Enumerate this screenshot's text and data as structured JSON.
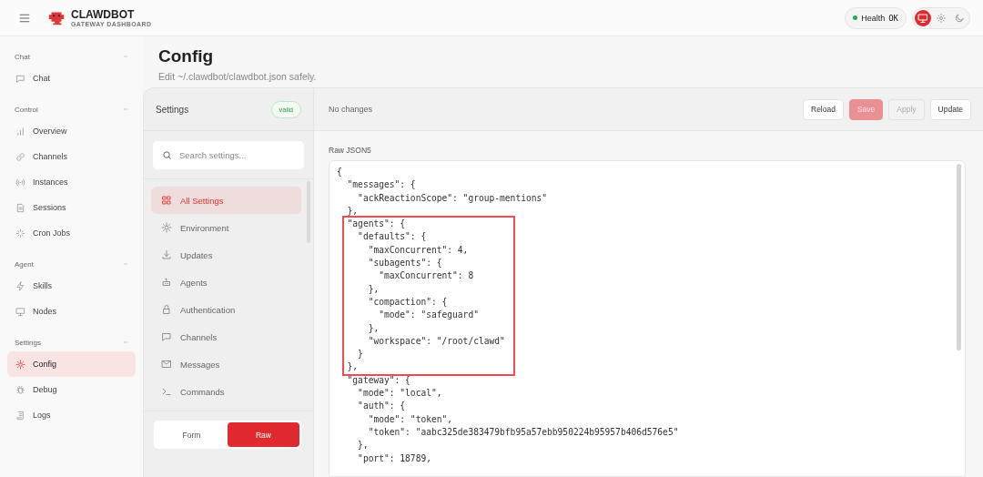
{
  "header": {
    "brand": "CLAWDBOT",
    "subtitle": "GATEWAY DASHBOARD",
    "health": {
      "label": "Health",
      "value": "OK",
      "ok": true
    },
    "theme_modes": [
      {
        "selected": true
      },
      {
        "selected": false
      },
      {
        "selected": false
      }
    ]
  },
  "sidebar": {
    "groups": [
      {
        "title": "Chat",
        "expanded": true,
        "items": [
          {
            "label": "Chat",
            "selected": false
          }
        ]
      },
      {
        "title": "Control",
        "expanded": true,
        "items": [
          {
            "label": "Overview",
            "selected": false
          },
          {
            "label": "Channels",
            "selected": false
          },
          {
            "label": "Instances",
            "selected": false
          },
          {
            "label": "Sessions",
            "selected": false
          },
          {
            "label": "Cron Jobs",
            "selected": false
          }
        ]
      },
      {
        "title": "Agent",
        "expanded": true,
        "items": [
          {
            "label": "Skills",
            "selected": false
          },
          {
            "label": "Nodes",
            "selected": false
          }
        ]
      },
      {
        "title": "Settings",
        "expanded": true,
        "items": [
          {
            "label": "Config",
            "selected": true
          },
          {
            "label": "Debug",
            "selected": false
          },
          {
            "label": "Logs",
            "selected": false
          }
        ]
      }
    ]
  },
  "page": {
    "title": "Config",
    "subtitle": "Edit ~/.clawdbot/clawdbot.json safely."
  },
  "settings_panel": {
    "title": "Settings",
    "status": "valid",
    "valid": true,
    "search": {
      "placeholder": "Search settings..."
    },
    "items": [
      {
        "label": "All Settings",
        "selected": true
      },
      {
        "label": "Environment",
        "selected": false
      },
      {
        "label": "Updates",
        "selected": false
      },
      {
        "label": "Agents",
        "selected": false
      },
      {
        "label": "Authentication",
        "selected": false
      },
      {
        "label": "Channels",
        "selected": false
      },
      {
        "label": "Messages",
        "selected": false
      },
      {
        "label": "Commands",
        "selected": false
      }
    ],
    "modes": [
      {
        "label": "Form",
        "selected": false
      },
      {
        "label": "Raw",
        "selected": true
      }
    ]
  },
  "editor": {
    "status": "No changes",
    "buttons": [
      {
        "label": "Reload",
        "kind": "default",
        "disabled": false
      },
      {
        "label": "Save",
        "kind": "primary",
        "disabled": true
      },
      {
        "label": "Apply",
        "kind": "default",
        "disabled": true
      },
      {
        "label": "Update",
        "kind": "default",
        "disabled": false
      }
    ],
    "label": "Raw JSON5",
    "lines": [
      {
        "text": "{",
        "highlighted": false
      },
      {
        "text": "  \"messages\": {",
        "highlighted": false
      },
      {
        "text": "    \"ackReactionScope\": \"group-mentions\"",
        "highlighted": false
      },
      {
        "text": "  },",
        "highlighted": false
      },
      {
        "text": "  \"agents\": {",
        "highlighted": true
      },
      {
        "text": "    \"defaults\": {",
        "highlighted": true
      },
      {
        "text": "      \"maxConcurrent\": 4,",
        "highlighted": true
      },
      {
        "text": "      \"subagents\": {",
        "highlighted": true
      },
      {
        "text": "        \"maxConcurrent\": 8",
        "highlighted": true
      },
      {
        "text": "      },",
        "highlighted": true
      },
      {
        "text": "      \"compaction\": {",
        "highlighted": true
      },
      {
        "text": "        \"mode\": \"safeguard\"",
        "highlighted": true
      },
      {
        "text": "      },",
        "highlighted": true
      },
      {
        "text": "      \"workspace\": \"/root/clawd\"",
        "highlighted": true
      },
      {
        "text": "    }",
        "highlighted": true
      },
      {
        "text": "  },",
        "highlighted": true
      },
      {
        "text": "  \"gateway\": {",
        "highlighted": false
      },
      {
        "text": "    \"mode\": \"local\",",
        "highlighted": false
      },
      {
        "text": "    \"auth\": {",
        "highlighted": false
      },
      {
        "text": "      \"mode\": \"token\",",
        "highlighted": false
      },
      {
        "text": "      \"token\": \"aabc325de383479bfb95a57ebb950224b95957b406d576e5\"",
        "highlighted": false
      },
      {
        "text": "    },",
        "highlighted": false
      },
      {
        "text": "    \"port\": 18789,",
        "highlighted": false
      }
    ]
  }
}
